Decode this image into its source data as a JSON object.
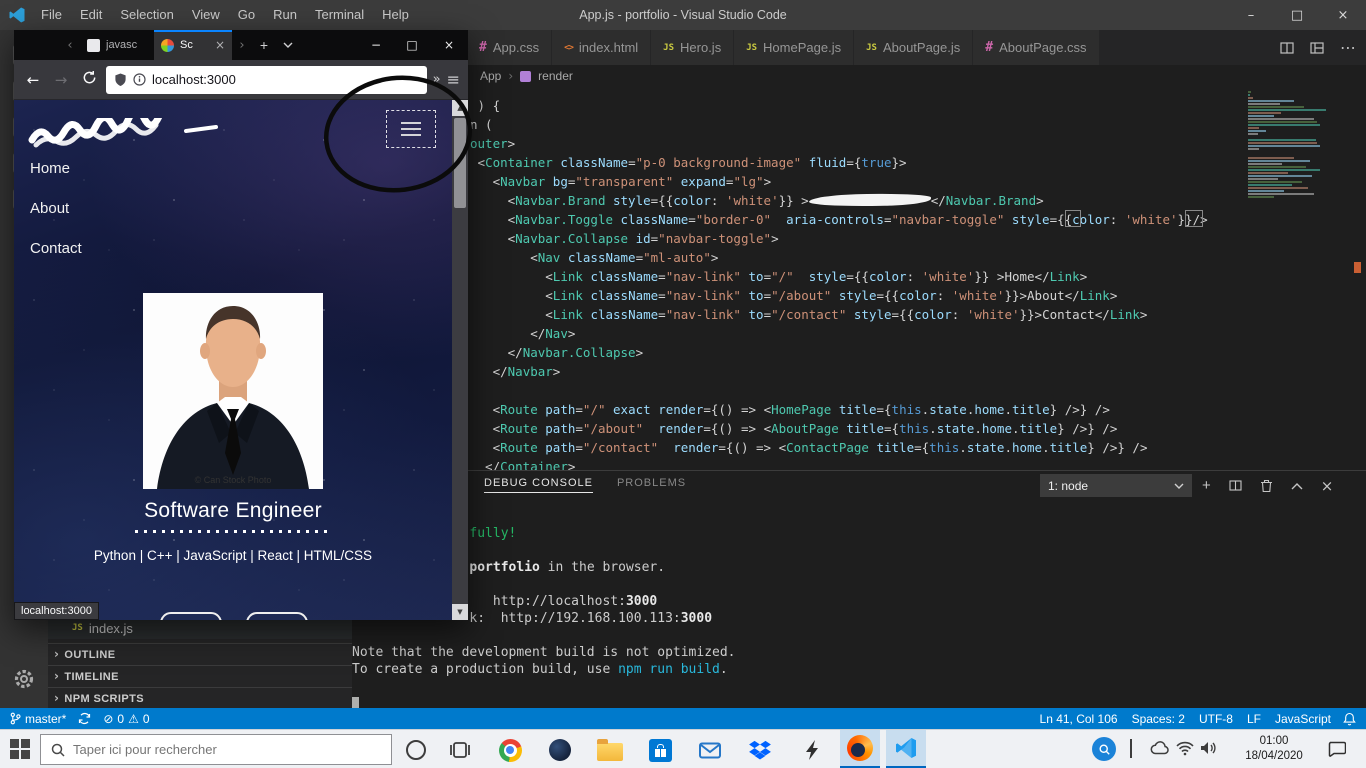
{
  "vscode": {
    "titlebar": {
      "title": "App.js - portfolio - Visual Studio Code",
      "menus": [
        "File",
        "Edit",
        "Selection",
        "View",
        "Go",
        "Run",
        "Terminal",
        "Help"
      ]
    },
    "tabs": [
      {
        "label": "App.css",
        "lang": "css"
      },
      {
        "label": "index.html",
        "lang": "html"
      },
      {
        "label": "Hero.js",
        "lang": "js"
      },
      {
        "label": "HomePage.js",
        "lang": "js"
      },
      {
        "label": "AboutPage.js",
        "lang": "js"
      },
      {
        "label": "AboutPage.css",
        "lang": "css"
      }
    ],
    "breadcrumb": {
      "items": [
        "App",
        "render"
      ]
    },
    "code_lines": [
      " ) {",
      "n (",
      "outer>",
      " <Container className=\"p-0 background-image\" fluid={true}>",
      "   <Navbar bg=\"transparent\" expand=\"lg\">",
      "     <Navbar.Brand style={{color: 'white'}} >@@REDACT@@</Navbar.Brand>",
      "     <Navbar.Toggle className=\"border-0\"  aria-controls=\"navbar-toggle\" style={{color: 'white'}}/>",
      "     <Navbar.Collapse id=\"navbar-toggle\">",
      "        <Nav className=\"ml-auto\">",
      "          <Link className=\"nav-link\" to=\"/\"  style={{color: 'white'}} >Home</Link>",
      "          <Link className=\"nav-link\" to=\"/about\" style={{color: 'white'}}>About</Link>",
      "          <Link className=\"nav-link\" to=\"/contact\" style={{color: 'white'}}>Contact</Link>",
      "        </Nav>",
      "     </Navbar.Collapse>",
      "   </Navbar>",
      "",
      "   <Route path=\"/\" exact render={() => <HomePage title={this.state.home.title} />} />",
      "   <Route path=\"/about\"  render={() => <AboutPage title={this.state.home.title} />} />",
      "   <Route path=\"/contact\"  render={() => <ContactPage title={this.state.home.title} />} />",
      "  </Container>"
    ],
    "panel": {
      "tabs": [
        {
          "label": "DEBUG CONSOLE",
          "active": true
        },
        {
          "label": "PROBLEMS",
          "active": false
        }
      ],
      "session_dropdown": "1: node",
      "console_lines": [
        [
          {
            "t": "               fully!",
            "s": "green"
          }
        ],
        [],
        [
          {
            "t": "               "
          },
          {
            "t": "portfolio",
            "s": "bold"
          },
          {
            "t": " in the browser."
          }
        ],
        [],
        [
          {
            "t": "                  http://localhost:"
          },
          {
            "t": "3000",
            "s": "bold"
          }
        ],
        [
          {
            "t": "               k:  http://192.168.100.113:"
          },
          {
            "t": "3000",
            "s": "bold"
          }
        ],
        [],
        [
          {
            "t": "Note that the development build is not optimized."
          }
        ],
        [
          {
            "t": "To create a production build, use "
          },
          {
            "t": "npm run build",
            "s": "cyan"
          },
          {
            "t": "."
          }
        ],
        [],
        [
          {
            "t": " ",
            "s": "cursor"
          }
        ]
      ]
    },
    "explorer": {
      "file": "index.js",
      "sections": [
        "OUTLINE",
        "TIMELINE",
        "NPM SCRIPTS"
      ]
    },
    "statusbar": {
      "branch": "master*",
      "errors": "0",
      "warnings": "0",
      "items_right": [
        "Ln 41, Col 106",
        "Spaces: 2",
        "UTF-8",
        "LF",
        "JavaScript"
      ]
    }
  },
  "firefox": {
    "tabs": [
      {
        "label": "javasc",
        "active": false
      },
      {
        "label": "Sc",
        "active": true
      }
    ],
    "url": "localhost:3000",
    "page": {
      "nav_links": [
        "Home",
        "About",
        "Contact"
      ],
      "photo_credit": "© Can Stock Photo",
      "headline": "Software Engineer",
      "skills": "Python | C++ | JavaScript | React | HTML/CSS",
      "status_tooltip": "localhost:3000"
    }
  },
  "taskbar": {
    "search_placeholder": "Taper ici pour rechercher",
    "clock_time": "01:00",
    "clock_date": "18/04/2020"
  },
  "colors": {
    "statusbar_blue": "#007ACC",
    "console_green": "#25B865",
    "console_cyan": "#29B8DB",
    "firefox_accent": "#0A84FF",
    "taskbar_active_underline": "#0067C0"
  }
}
